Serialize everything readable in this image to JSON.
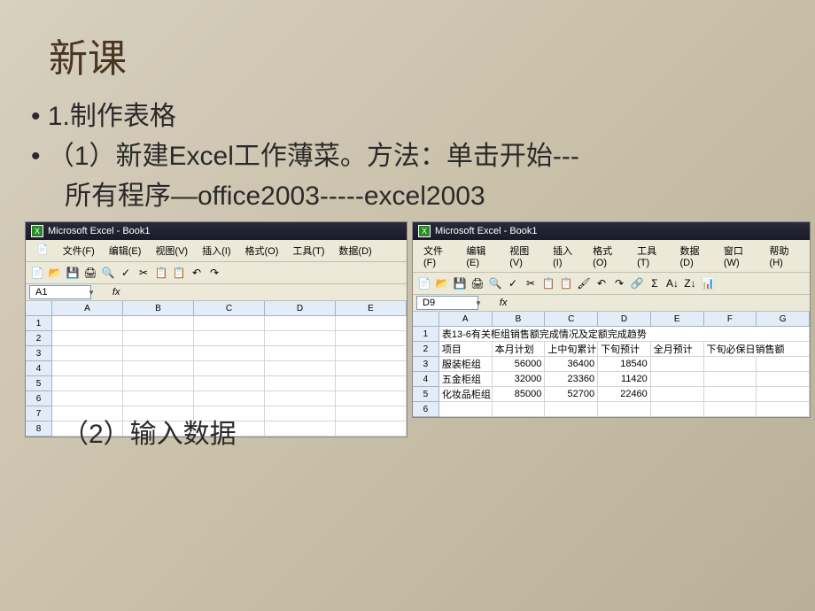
{
  "slide": {
    "title": "新课",
    "bullet1": "1.制作表格",
    "bullet2": "（1）新建Excel工作薄菜。方法：单击开始---",
    "bullet2b": "所有程序—office2003-----excel2003",
    "section2": "（2）输入数据"
  },
  "excel_left": {
    "title": "Microsoft Excel - Book1",
    "menu": [
      "文件(F)",
      "编辑(E)",
      "视图(V)",
      "插入(I)",
      "格式(O)",
      "工具(T)",
      "数据(D)"
    ],
    "namebox": "A1",
    "fx": "fx",
    "cols": [
      "A",
      "B",
      "C",
      "D",
      "E"
    ],
    "rows": [
      "1",
      "2",
      "3",
      "4",
      "5",
      "6",
      "7",
      "8"
    ]
  },
  "excel_right": {
    "title": "Microsoft Excel - Book1",
    "menu": [
      "文件(F)",
      "编辑(E)",
      "视图(V)",
      "插入(I)",
      "格式(O)",
      "工具(T)",
      "数据(D)",
      "窗口(W)",
      "帮助(H)"
    ],
    "namebox": "D9",
    "fx": "fx",
    "cols": [
      "A",
      "B",
      "C",
      "D",
      "E",
      "F",
      "G"
    ],
    "rows": [
      "1",
      "2",
      "3",
      "4",
      "5",
      "6"
    ],
    "data": {
      "r1": {
        "A": "表13-6有关柜组销售额完成情况及定额完成趋势"
      },
      "r2": {
        "A": "项目",
        "B": "本月计划",
        "C": "上中旬累计",
        "D": "下旬预计",
        "E": "全月预计",
        "F": "下旬必保日销售额"
      },
      "r3": {
        "A": "服装柜组",
        "B": "56000",
        "C": "36400",
        "D": "18540"
      },
      "r4": {
        "A": "五金柜组",
        "B": "32000",
        "C": "23360",
        "D": "11420"
      },
      "r5": {
        "A": "化妆品柜组",
        "B": "85000",
        "C": "52700",
        "D": "22460"
      }
    }
  },
  "chart_data": {
    "type": "table",
    "title": "表13-6有关柜组销售额完成情况及定额完成趋势",
    "columns": [
      "项目",
      "本月计划",
      "上中旬累计",
      "下旬预计",
      "全月预计",
      "下旬必保日销售额"
    ],
    "rows": [
      {
        "项目": "服装柜组",
        "本月计划": 56000,
        "上中旬累计": 36400,
        "下旬预计": 18540
      },
      {
        "项目": "五金柜组",
        "本月计划": 32000,
        "上中旬累计": 23360,
        "下旬预计": 11420
      },
      {
        "项目": "化妆品柜组",
        "本月计划": 85000,
        "上中旬累计": 52700,
        "下旬预计": 22460
      }
    ]
  }
}
